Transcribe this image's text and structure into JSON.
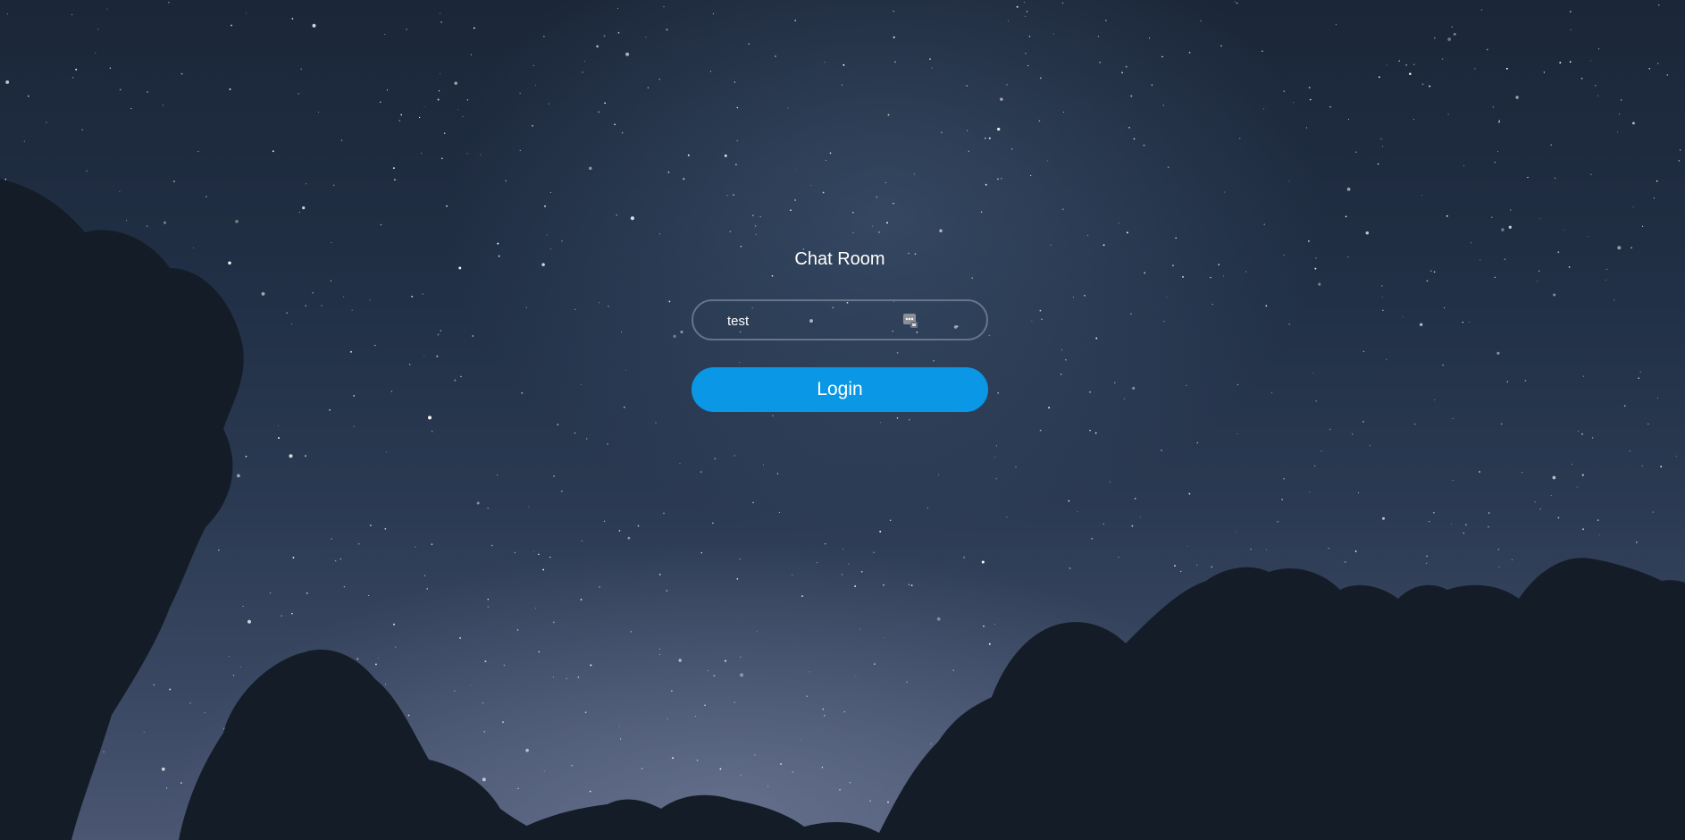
{
  "page": {
    "title": "Chat Room"
  },
  "login_form": {
    "username_value": "test",
    "field_icon": "password-manager-icon",
    "submit_label": "Login"
  },
  "colors": {
    "login_button": "#0a97e6",
    "text": "#ffffff",
    "field_border": "#969fb4"
  }
}
